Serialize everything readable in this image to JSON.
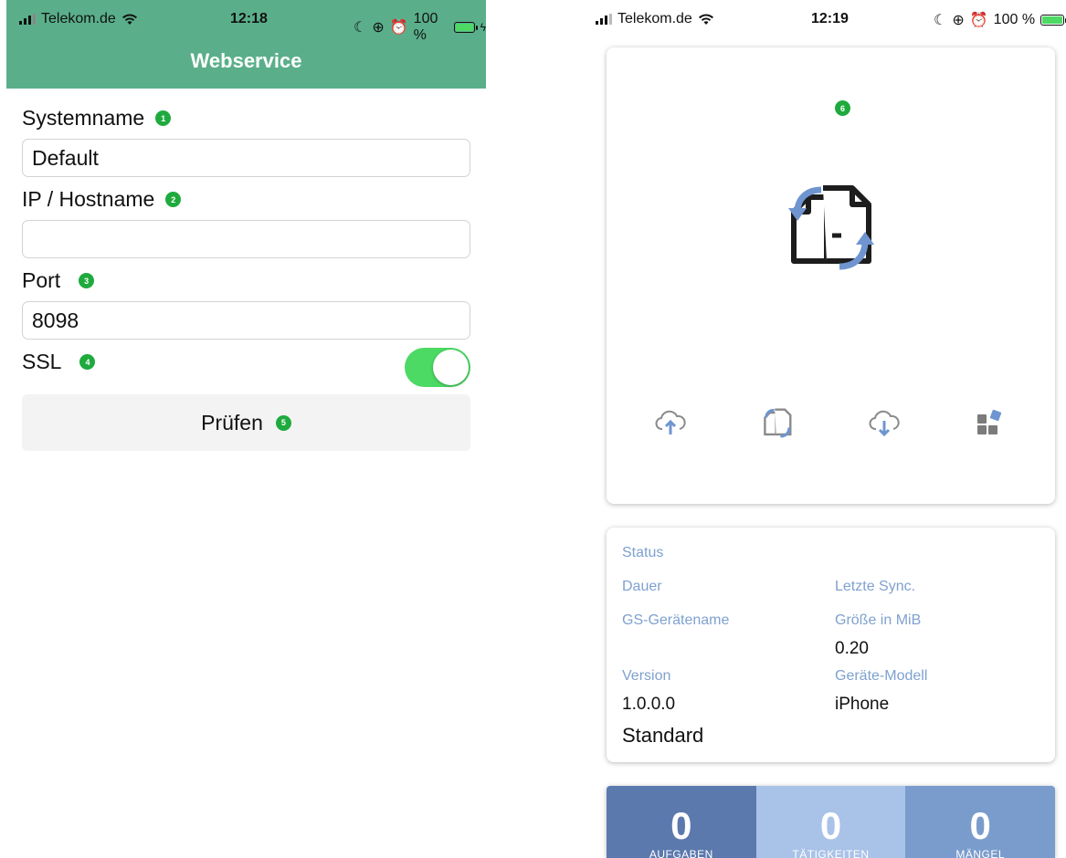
{
  "left": {
    "status": {
      "carrier": "Telekom.de",
      "time": "12:18",
      "battery": "100 %",
      "battery_level": 1.0
    },
    "title": "Webservice",
    "fields": [
      {
        "label": "Systemname",
        "badge": "1",
        "value": "Default"
      },
      {
        "label": "IP / Hostname",
        "badge": "2",
        "value": ""
      },
      {
        "label": "Port",
        "badge": "3",
        "value": "8098"
      }
    ],
    "ssl": {
      "label": "SSL",
      "badge": "4",
      "on": true
    },
    "check_button": {
      "label": "Prüfen",
      "badge": "5"
    }
  },
  "right": {
    "status": {
      "carrier": "Telekom.de",
      "time": "12:19",
      "battery": "100 %",
      "battery_level": 1.0
    },
    "sync_badge": "6",
    "actions": [
      "upload-cloud-icon",
      "sync-docs-icon",
      "download-cloud-icon",
      "modules-icon"
    ],
    "info": {
      "status_label": "Status",
      "duration_label": "Dauer",
      "last_sync_label": "Letzte Sync.",
      "device_name_label": "GS-Gerätename",
      "size_label": "Größe in MiB",
      "size_value": "0.20",
      "version_label": "Version",
      "version_value": "1.0.0.0",
      "model_label": "Geräte-Modell",
      "model_value": "iPhone",
      "system_value": "Standard"
    },
    "tiles": [
      {
        "count": "0",
        "label": "AUFGABEN",
        "color": "#5b79ad"
      },
      {
        "count": "0",
        "label": "TÄTIGKEITEN",
        "color": "#a9c2e8"
      },
      {
        "count": "0",
        "label": "MÄNGEL",
        "color": "#7a9ccd"
      }
    ]
  },
  "colors": {
    "nav_green": "#5aaf8a",
    "badge_green": "#1faa3e",
    "toggle_green": "#4cd964",
    "label_blue": "#7fa1cf",
    "icon_blue": "#6f95d0"
  }
}
